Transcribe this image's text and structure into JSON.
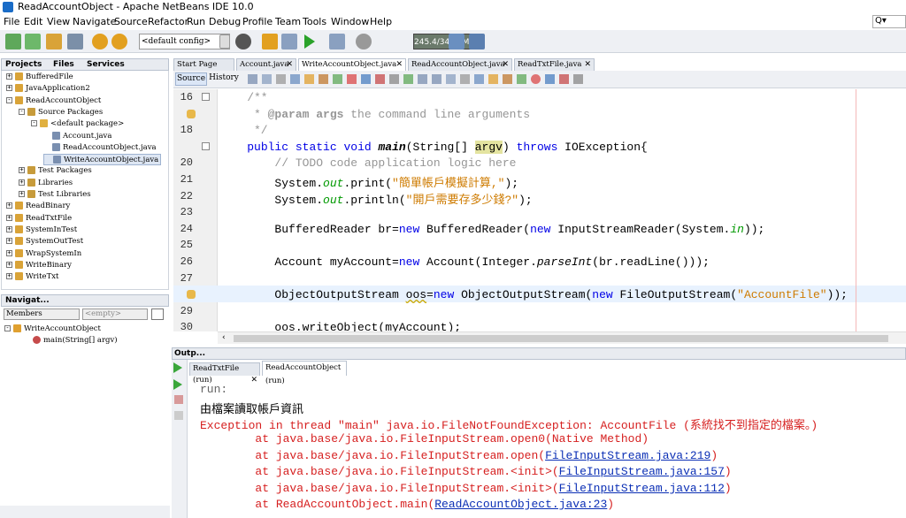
{
  "window": {
    "title": "ReadAccountObject - Apache NetBeans IDE 10.0"
  },
  "menu": [
    "File",
    "Edit",
    "View",
    "Navigate",
    "Source",
    "Refactor",
    "Run",
    "Debug",
    "Profile",
    "Team",
    "Tools",
    "Window",
    "Help"
  ],
  "search": {
    "placeholder": "Q▾"
  },
  "toolbar": {
    "config": "<default config>",
    "memory": "245.4/347.0MB"
  },
  "projects_panel": {
    "tabs": [
      "Projects",
      "Files",
      "Services"
    ],
    "tree": [
      {
        "label": "BufferedFile",
        "level": 0,
        "toggle": "+"
      },
      {
        "label": "JavaApplication2",
        "level": 0,
        "toggle": "+"
      },
      {
        "label": "ReadAccountObject",
        "level": 0,
        "toggle": "-"
      },
      {
        "label": "Source Packages",
        "level": 1,
        "toggle": "-"
      },
      {
        "label": "<default package>",
        "level": 2,
        "toggle": "-"
      },
      {
        "label": "Account.java",
        "level": 3,
        "toggle": ""
      },
      {
        "label": "ReadAccountObject.java",
        "level": 3,
        "toggle": ""
      },
      {
        "label": "WriteAccountObject.java",
        "level": 3,
        "toggle": "",
        "selected": true
      },
      {
        "label": "Test Packages",
        "level": 1,
        "toggle": "+"
      },
      {
        "label": "Libraries",
        "level": 1,
        "toggle": "+"
      },
      {
        "label": "Test Libraries",
        "level": 1,
        "toggle": "+"
      },
      {
        "label": "ReadBinary",
        "level": 0,
        "toggle": "+"
      },
      {
        "label": "ReadTxtFile",
        "level": 0,
        "toggle": "+"
      },
      {
        "label": "SystemInTest",
        "level": 0,
        "toggle": "+"
      },
      {
        "label": "SystemOutTest",
        "level": 0,
        "toggle": "+"
      },
      {
        "label": "WrapSystemIn",
        "level": 0,
        "toggle": "+"
      },
      {
        "label": "WriteBinary",
        "level": 0,
        "toggle": "+"
      },
      {
        "label": "WriteTxt",
        "level": 0,
        "toggle": "+"
      }
    ]
  },
  "navigator": {
    "title": "Navigat...",
    "members_label": "Members",
    "filter_placeholder": "<empty>",
    "root": "WriteAccountObject",
    "method": "main(String[] argv)"
  },
  "editor": {
    "tabs": [
      "Start Page",
      "Account.java",
      "WriteAccountObject.java",
      "ReadAccountObject.java",
      "ReadTxtFile.java"
    ],
    "active_tab": "WriteAccountObject.java",
    "view_tabs": [
      "Source",
      "History"
    ],
    "line_numbers": [
      "16",
      "",
      "18",
      "",
      "20",
      "21",
      "22",
      "23",
      "24",
      "25",
      "26",
      "27",
      "",
      "29",
      "30"
    ],
    "lines": [
      "    /**",
      "     * @param args the command line arguments",
      "     */",
      "    public static void main(String[] argv) throws IOException{",
      "        // TODO code application logic here",
      "        System.out.print(\"簡單帳戶模擬計算,\");",
      "        System.out.println(\"開戶需要存多少錢?\");",
      "",
      "        BufferedReader br=new BufferedReader(new InputStreamReader(System.in));",
      "",
      "        Account myAccount=new Account(Integer.parseInt(br.readLine()));",
      "",
      "        ObjectOutputStream oos=new ObjectOutputStream(new FileOutputStream(\"AccountFile\"));",
      "",
      "        oos.writeObject(myAccount);"
    ]
  },
  "output": {
    "title": "Outp...",
    "tabs": [
      "ReadTxtFile (run)",
      "ReadAccountObject (run)"
    ],
    "lines": {
      "run": "run:",
      "msg": "由檔案讀取帳戶資訊",
      "exc": "Exception in thread \"main\" java.io.FileNotFoundException: AccountFile (系統找不到指定的檔案。)",
      "at1_pre": "        at java.base/java.io.FileInputStream.open0(Native Method)",
      "at2_pre": "        at java.base/java.io.FileInputStream.open(",
      "at2_link": "FileInputStream.java:219",
      "at3_pre": "        at java.base/java.io.FileInputStream.<init>(",
      "at3_link": "FileInputStream.java:157",
      "at4_pre": "        at java.base/java.io.FileInputStream.<init>(",
      "at4_link": "FileInputStream.java:112",
      "at5_pre": "        at ReadAccountObject.main(",
      "at5_link": "ReadAccountObject.java:23",
      "close": ")"
    }
  },
  "colors": {
    "keyword": "#0000e6",
    "comment": "#969696",
    "string": "#ce7b00",
    "error": "#d62020",
    "link": "#0b2fb5",
    "highlight": "#e8f2fe"
  }
}
